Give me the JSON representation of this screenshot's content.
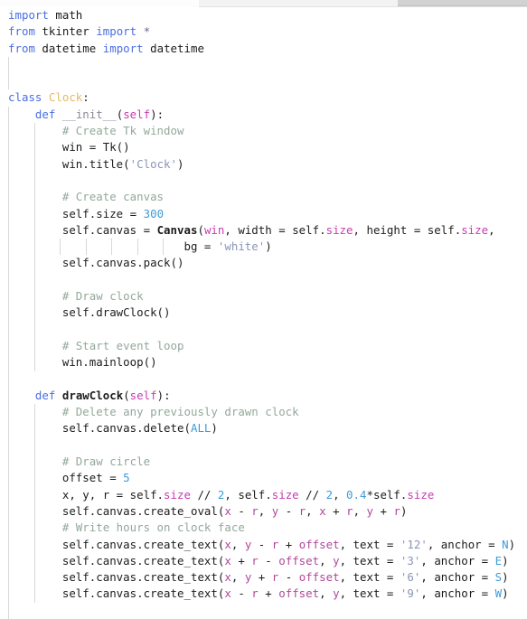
{
  "app": {
    "type": "code-editor",
    "language": "Python",
    "theme": "light"
  },
  "scrollbar": {
    "orientation": "horizontal",
    "name": "horizontal-scrollbar"
  },
  "colors": {
    "background": "#ffffff",
    "foreground": "#1c1c1c",
    "keyword": "#4a6ee0",
    "class_name": "#e8b862",
    "function_name": "#1c1c1c",
    "dunder": "#8a8a99",
    "parameter": "#c83bb0",
    "attribute": "#c83bb0",
    "number": "#3d9bd6",
    "string": "#8a94b8",
    "comment": "#93a89a",
    "constant": "#3d9bd6",
    "indent_guide": "#d8d8d8",
    "scrollbar_thumb": "#d2d2d2",
    "scrollbar_track": "#f3f3f3"
  },
  "code": {
    "lines": [
      {
        "n": 1,
        "indent": 0,
        "guides": 0,
        "tokens": [
          {
            "t": "import",
            "c": "kw"
          },
          {
            "t": " math",
            "c": "plain"
          }
        ]
      },
      {
        "n": 2,
        "indent": 0,
        "guides": 0,
        "tokens": [
          {
            "t": "from",
            "c": "kw"
          },
          {
            "t": " tkinter ",
            "c": "plain"
          },
          {
            "t": "import",
            "c": "kw"
          },
          {
            "t": " ",
            "c": "plain"
          },
          {
            "t": "*",
            "c": "star"
          }
        ]
      },
      {
        "n": 3,
        "indent": 0,
        "guides": 0,
        "tokens": [
          {
            "t": "from",
            "c": "kw"
          },
          {
            "t": " datetime ",
            "c": "plain"
          },
          {
            "t": "import",
            "c": "kw"
          },
          {
            "t": " datetime",
            "c": "plain"
          }
        ]
      },
      {
        "n": 4,
        "indent": 0,
        "guides": 1,
        "tokens": []
      },
      {
        "n": 5,
        "indent": 0,
        "guides": 1,
        "tokens": []
      },
      {
        "n": 6,
        "indent": 0,
        "guides": 0,
        "tokens": [
          {
            "t": "class",
            "c": "kw"
          },
          {
            "t": " ",
            "c": "plain"
          },
          {
            "t": "Clock",
            "c": "cls"
          },
          {
            "t": ":",
            "c": "plain"
          }
        ]
      },
      {
        "n": 7,
        "indent": 1,
        "guides": 1,
        "tokens": [
          {
            "t": "def",
            "c": "kw"
          },
          {
            "t": " ",
            "c": "plain"
          },
          {
            "t": "__init__",
            "c": "dunder"
          },
          {
            "t": "(",
            "c": "plain"
          },
          {
            "t": "self",
            "c": "selfp"
          },
          {
            "t": "):",
            "c": "plain"
          }
        ]
      },
      {
        "n": 8,
        "indent": 2,
        "guides": 2,
        "tokens": [
          {
            "t": "# Create Tk window",
            "c": "cmt"
          }
        ]
      },
      {
        "n": 9,
        "indent": 2,
        "guides": 2,
        "tokens": [
          {
            "t": "win = Tk()",
            "c": "plain"
          }
        ]
      },
      {
        "n": 10,
        "indent": 2,
        "guides": 2,
        "tokens": [
          {
            "t": "win.title(",
            "c": "plain"
          },
          {
            "t": "'Clock'",
            "c": "str"
          },
          {
            "t": ")",
            "c": "plain"
          }
        ]
      },
      {
        "n": 11,
        "indent": 0,
        "guides": 2,
        "tokens": []
      },
      {
        "n": 12,
        "indent": 2,
        "guides": 2,
        "tokens": [
          {
            "t": "# Create canvas",
            "c": "cmt"
          }
        ]
      },
      {
        "n": 13,
        "indent": 2,
        "guides": 2,
        "tokens": [
          {
            "t": "self.size = ",
            "c": "plain"
          },
          {
            "t": "300",
            "c": "num"
          }
        ]
      },
      {
        "n": 14,
        "indent": 2,
        "guides": 2,
        "tokens": [
          {
            "t": "self.canvas = ",
            "c": "plain"
          },
          {
            "t": "Canvas",
            "c": "fn"
          },
          {
            "t": "(",
            "c": "plain"
          },
          {
            "t": "win",
            "c": "selfp"
          },
          {
            "t": ", width = self.",
            "c": "plain"
          },
          {
            "t": "size",
            "c": "attr"
          },
          {
            "t": ", height = self.",
            "c": "plain"
          },
          {
            "t": "size",
            "c": "attr"
          },
          {
            "t": ",",
            "c": "plain"
          }
        ]
      },
      {
        "n": 15,
        "indent": 0,
        "guides": 7,
        "cont": true,
        "tokens": [
          {
            "t": "bg = ",
            "c": "plain"
          },
          {
            "t": "'white'",
            "c": "str"
          },
          {
            "t": ")",
            "c": "plain"
          }
        ]
      },
      {
        "n": 16,
        "indent": 2,
        "guides": 2,
        "tokens": [
          {
            "t": "self.canvas.pack()",
            "c": "plain"
          }
        ]
      },
      {
        "n": 17,
        "indent": 0,
        "guides": 2,
        "tokens": []
      },
      {
        "n": 18,
        "indent": 2,
        "guides": 2,
        "tokens": [
          {
            "t": "# Draw clock",
            "c": "cmt"
          }
        ]
      },
      {
        "n": 19,
        "indent": 2,
        "guides": 2,
        "tokens": [
          {
            "t": "self.drawClock()",
            "c": "plain"
          }
        ]
      },
      {
        "n": 20,
        "indent": 0,
        "guides": 2,
        "tokens": []
      },
      {
        "n": 21,
        "indent": 2,
        "guides": 2,
        "tokens": [
          {
            "t": "# Start event loop",
            "c": "cmt"
          }
        ]
      },
      {
        "n": 22,
        "indent": 2,
        "guides": 2,
        "tokens": [
          {
            "t": "win.mainloop()",
            "c": "plain"
          }
        ]
      },
      {
        "n": 23,
        "indent": 0,
        "guides": 1,
        "tokens": []
      },
      {
        "n": 24,
        "indent": 1,
        "guides": 1,
        "tokens": [
          {
            "t": "def",
            "c": "kw"
          },
          {
            "t": " ",
            "c": "plain"
          },
          {
            "t": "drawClock",
            "c": "fn"
          },
          {
            "t": "(",
            "c": "plain"
          },
          {
            "t": "self",
            "c": "selfp"
          },
          {
            "t": "):",
            "c": "plain"
          }
        ]
      },
      {
        "n": 25,
        "indent": 2,
        "guides": 2,
        "tokens": [
          {
            "t": "# Delete any previously drawn clock",
            "c": "cmt"
          }
        ]
      },
      {
        "n": 26,
        "indent": 2,
        "guides": 2,
        "tokens": [
          {
            "t": "self.canvas.delete(",
            "c": "plain"
          },
          {
            "t": "ALL",
            "c": "const"
          },
          {
            "t": ")",
            "c": "plain"
          }
        ]
      },
      {
        "n": 27,
        "indent": 0,
        "guides": 2,
        "tokens": []
      },
      {
        "n": 28,
        "indent": 2,
        "guides": 2,
        "tokens": [
          {
            "t": "# Draw circle",
            "c": "cmt"
          }
        ]
      },
      {
        "n": 29,
        "indent": 2,
        "guides": 2,
        "tokens": [
          {
            "t": "offset = ",
            "c": "plain"
          },
          {
            "t": "5",
            "c": "num"
          }
        ]
      },
      {
        "n": 30,
        "indent": 2,
        "guides": 2,
        "tokens": [
          {
            "t": "x, y, r = self.",
            "c": "plain"
          },
          {
            "t": "size",
            "c": "attr"
          },
          {
            "t": " // ",
            "c": "plain"
          },
          {
            "t": "2",
            "c": "num"
          },
          {
            "t": ", self.",
            "c": "plain"
          },
          {
            "t": "size",
            "c": "attr"
          },
          {
            "t": " // ",
            "c": "plain"
          },
          {
            "t": "2",
            "c": "num"
          },
          {
            "t": ", ",
            "c": "plain"
          },
          {
            "t": "0.4",
            "c": "num"
          },
          {
            "t": "*self.",
            "c": "plain"
          },
          {
            "t": "size",
            "c": "attr"
          }
        ]
      },
      {
        "n": 31,
        "indent": 2,
        "guides": 2,
        "tokens": [
          {
            "t": "self.canvas.create_oval(",
            "c": "plain"
          },
          {
            "t": "x",
            "c": "var"
          },
          {
            "t": " - ",
            "c": "plain"
          },
          {
            "t": "r",
            "c": "var"
          },
          {
            "t": ", ",
            "c": "plain"
          },
          {
            "t": "y",
            "c": "var"
          },
          {
            "t": " - ",
            "c": "plain"
          },
          {
            "t": "r",
            "c": "var"
          },
          {
            "t": ", ",
            "c": "plain"
          },
          {
            "t": "x",
            "c": "var"
          },
          {
            "t": " + ",
            "c": "plain"
          },
          {
            "t": "r",
            "c": "var"
          },
          {
            "t": ", ",
            "c": "plain"
          },
          {
            "t": "y",
            "c": "var"
          },
          {
            "t": " + ",
            "c": "plain"
          },
          {
            "t": "r",
            "c": "var"
          },
          {
            "t": ")",
            "c": "plain"
          }
        ]
      },
      {
        "n": 32,
        "indent": 2,
        "guides": 2,
        "tokens": [
          {
            "t": "# Write hours on clock face",
            "c": "cmt"
          }
        ]
      },
      {
        "n": 33,
        "indent": 2,
        "guides": 2,
        "tokens": [
          {
            "t": "self.canvas.create_text(",
            "c": "plain"
          },
          {
            "t": "x",
            "c": "var"
          },
          {
            "t": ", ",
            "c": "plain"
          },
          {
            "t": "y",
            "c": "var"
          },
          {
            "t": " - ",
            "c": "plain"
          },
          {
            "t": "r",
            "c": "var"
          },
          {
            "t": " + ",
            "c": "plain"
          },
          {
            "t": "offset",
            "c": "var"
          },
          {
            "t": ", text = ",
            "c": "plain"
          },
          {
            "t": "'12'",
            "c": "str"
          },
          {
            "t": ", anchor = ",
            "c": "plain"
          },
          {
            "t": "N",
            "c": "const"
          },
          {
            "t": ")",
            "c": "plain"
          }
        ]
      },
      {
        "n": 34,
        "indent": 2,
        "guides": 2,
        "tokens": [
          {
            "t": "self.canvas.create_text(",
            "c": "plain"
          },
          {
            "t": "x",
            "c": "var"
          },
          {
            "t": " + ",
            "c": "plain"
          },
          {
            "t": "r",
            "c": "var"
          },
          {
            "t": " - ",
            "c": "plain"
          },
          {
            "t": "offset",
            "c": "var"
          },
          {
            "t": ", ",
            "c": "plain"
          },
          {
            "t": "y",
            "c": "var"
          },
          {
            "t": ", text = ",
            "c": "plain"
          },
          {
            "t": "'3'",
            "c": "str"
          },
          {
            "t": ", anchor = ",
            "c": "plain"
          },
          {
            "t": "E",
            "c": "const"
          },
          {
            "t": ")",
            "c": "plain"
          }
        ]
      },
      {
        "n": 35,
        "indent": 2,
        "guides": 2,
        "tokens": [
          {
            "t": "self.canvas.create_text(",
            "c": "plain"
          },
          {
            "t": "x",
            "c": "var"
          },
          {
            "t": ", ",
            "c": "plain"
          },
          {
            "t": "y",
            "c": "var"
          },
          {
            "t": " + ",
            "c": "plain"
          },
          {
            "t": "r",
            "c": "var"
          },
          {
            "t": " - ",
            "c": "plain"
          },
          {
            "t": "offset",
            "c": "var"
          },
          {
            "t": ", text = ",
            "c": "plain"
          },
          {
            "t": "'6'",
            "c": "str"
          },
          {
            "t": ", anchor = ",
            "c": "plain"
          },
          {
            "t": "S",
            "c": "const"
          },
          {
            "t": ")",
            "c": "plain"
          }
        ]
      },
      {
        "n": 36,
        "indent": 2,
        "guides": 2,
        "tokens": [
          {
            "t": "self.canvas.create_text(",
            "c": "plain"
          },
          {
            "t": "x",
            "c": "var"
          },
          {
            "t": " - ",
            "c": "plain"
          },
          {
            "t": "r",
            "c": "var"
          },
          {
            "t": " + ",
            "c": "plain"
          },
          {
            "t": "offset",
            "c": "var"
          },
          {
            "t": ", ",
            "c": "plain"
          },
          {
            "t": "y",
            "c": "var"
          },
          {
            "t": ", text = ",
            "c": "plain"
          },
          {
            "t": "'9'",
            "c": "str"
          },
          {
            "t": ", anchor = ",
            "c": "plain"
          },
          {
            "t": "W",
            "c": "const"
          },
          {
            "t": ")",
            "c": "plain"
          }
        ]
      },
      {
        "n": 37,
        "indent": 0,
        "guides": 1,
        "tokens": []
      }
    ]
  }
}
